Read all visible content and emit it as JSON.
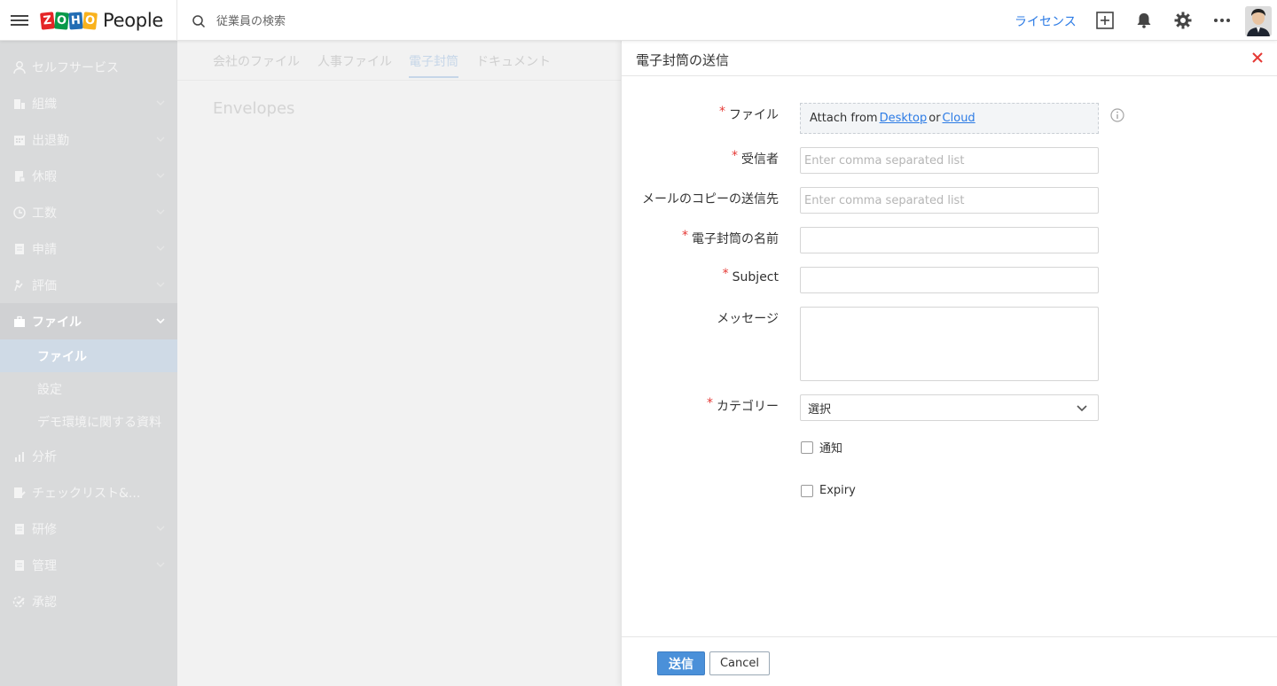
{
  "app": {
    "logo_letters": [
      "Z",
      "O",
      "H",
      "O"
    ],
    "logo_colors": [
      "#e42527",
      "#089949",
      "#226db4",
      "#f9b21d"
    ],
    "product_name": "People"
  },
  "topbar": {
    "search_placeholder": "従業員の検索",
    "license_label": "ライセンス",
    "icons": [
      "add-square-icon",
      "bell-icon",
      "gear-icon",
      "more-dots-icon"
    ]
  },
  "sidebar": {
    "items": [
      {
        "label": "セルフサービス",
        "icon": "user-icon",
        "has_chevron": false
      },
      {
        "label": "組織",
        "icon": "org-icon",
        "has_chevron": true
      },
      {
        "label": "出退勤",
        "icon": "calendar-icon",
        "has_chevron": true
      },
      {
        "label": "休暇",
        "icon": "leave-icon",
        "has_chevron": true
      },
      {
        "label": "工数",
        "icon": "clock-icon",
        "has_chevron": true
      },
      {
        "label": "申請",
        "icon": "form-icon",
        "has_chevron": true
      },
      {
        "label": "評価",
        "icon": "appraisal-icon",
        "has_chevron": true
      },
      {
        "label": "ファイル",
        "icon": "briefcase-icon",
        "has_chevron": true,
        "active": true
      },
      {
        "label": "分析",
        "icon": "chart-icon",
        "has_chevron": false
      },
      {
        "label": "チェックリスト&...",
        "icon": "checklist-icon",
        "has_chevron": false
      },
      {
        "label": "研修",
        "icon": "training-icon",
        "has_chevron": true
      },
      {
        "label": "管理",
        "icon": "manage-icon",
        "has_chevron": true
      },
      {
        "label": "承認",
        "icon": "approve-icon",
        "has_chevron": false
      }
    ],
    "sub_items": [
      {
        "label": "ファイル",
        "selected": true
      },
      {
        "label": "設定",
        "selected": false
      },
      {
        "label": "デモ環境に関する資料",
        "selected": false
      }
    ]
  },
  "main": {
    "tabs": [
      {
        "label": "会社のファイル"
      },
      {
        "label": "人事ファイル"
      },
      {
        "label": "電子封筒",
        "active": true
      },
      {
        "label": "ドキュメント"
      }
    ],
    "heading": "Envelopes"
  },
  "dialog": {
    "title": "電子封筒の送信",
    "required_mark": "*",
    "fields": {
      "file": {
        "label": "ファイル",
        "required": true,
        "attach_prefix": "Attach from",
        "desktop_link": "Desktop",
        "or_text": "or",
        "cloud_link": "Cloud"
      },
      "recipients": {
        "label": "受信者",
        "required": true,
        "placeholder": "Enter comma separated list",
        "value": ""
      },
      "cc": {
        "label": "メールのコピーの送信先",
        "required": false,
        "placeholder": "Enter comma separated list",
        "value": ""
      },
      "envelope_name": {
        "label": "電子封筒の名前",
        "required": true,
        "value": ""
      },
      "subject": {
        "label": "Subject",
        "required": true,
        "value": ""
      },
      "message": {
        "label": "メッセージ",
        "required": false,
        "value": ""
      },
      "category": {
        "label": "カテゴリー",
        "required": true,
        "selected": "選択"
      }
    },
    "checkboxes": [
      {
        "label": "通知",
        "checked": false
      },
      {
        "label": "Expiry",
        "checked": false
      }
    ],
    "submit_label": "送信",
    "cancel_label": "Cancel"
  },
  "colors": {
    "accent": "#2c7be5",
    "primary_button": "#4a90d9",
    "required": "#e53935",
    "close": "#e53935",
    "sidebar_bg": "#d9dadb"
  }
}
